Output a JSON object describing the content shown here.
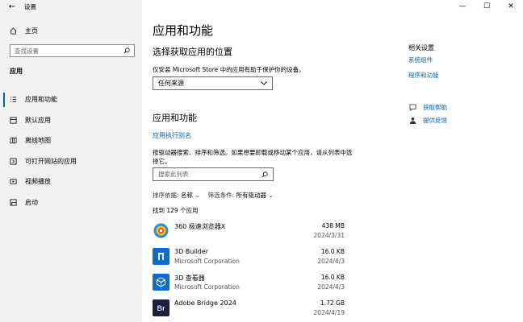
{
  "window": {
    "title": "设置",
    "controls": {
      "minimize": "—",
      "maximize": "☐",
      "close": "✕"
    },
    "back": "←"
  },
  "sidebar": {
    "home": "主页",
    "search_placeholder": "查找设置",
    "section": "应用",
    "items": [
      {
        "label": "应用和功能",
        "icon": "list-icon",
        "active": true
      },
      {
        "label": "默认应用",
        "icon": "default-apps-icon",
        "active": false
      },
      {
        "label": "离线地图",
        "icon": "map-icon",
        "active": false
      },
      {
        "label": "可打开网站的应用",
        "icon": "web-link-icon",
        "active": false
      },
      {
        "label": "视频播放",
        "icon": "video-icon",
        "active": false
      },
      {
        "label": "启动",
        "icon": "startup-icon",
        "active": false
      }
    ]
  },
  "main": {
    "title": "应用和功能",
    "choose_heading": "选择获取应用的位置",
    "choose_desc": "仅安装 Microsoft Store 中的应用有助于保护你的设备。",
    "source_dropdown": "任何来源",
    "apps_heading": "应用和功能",
    "alias_link": "应用执行别名",
    "apps_desc": "按驱动器搜索、排序和筛选。如果想要卸载或移动某个应用，请从列表中选择它。",
    "list_search_placeholder": "搜索此列表",
    "sort_label": "排序依据:",
    "sort_value": "名称",
    "filter_label": "筛选条件:",
    "filter_value": "所有驱动器",
    "found_text": "找到 129 个应用",
    "apps": [
      {
        "name": "360 极速浏览器X",
        "publisher": "",
        "size": "438 MB",
        "date": "2024/3/31",
        "icon_color": "#2a8ce0"
      },
      {
        "name": "3D Builder",
        "publisher": "Microsoft Corporation",
        "size": "16.0 KB",
        "date": "2024/4/3",
        "icon_color": "#0a6ed1"
      },
      {
        "name": "3D 查看器",
        "publisher": "Microsoft Corporation",
        "size": "16.0 KB",
        "date": "2024/4/3",
        "icon_color": "#0a6ed1"
      },
      {
        "name": "Adobe Bridge 2024",
        "publisher": "",
        "size": "1.72 GB",
        "date": "2024/4/19",
        "icon_color": "#1b1e3d",
        "icon_text": "Br"
      }
    ]
  },
  "related": {
    "title": "相关设置",
    "links": [
      "系统组件",
      "程序和功能"
    ]
  },
  "help": {
    "get_help": "获取帮助",
    "feedback": "提供反馈"
  },
  "colors": {
    "accent": "#0063b1",
    "sidebar_bg": "#f2f2f2"
  }
}
